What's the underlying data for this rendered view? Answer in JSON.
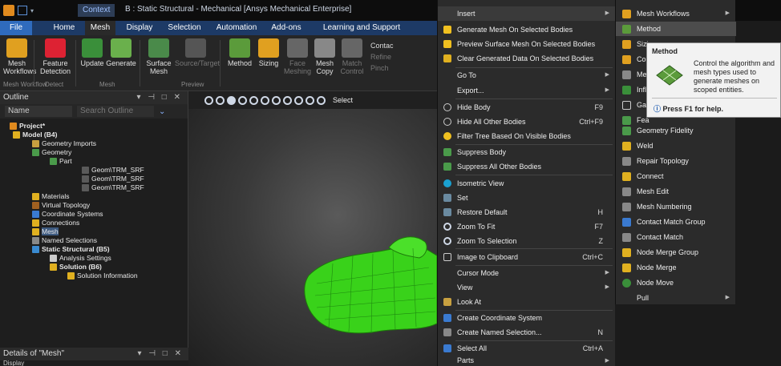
{
  "window": {
    "context_label": "Context",
    "title": "B : Static Structural - Mechanical [Ansys Mechanical Enterprise]"
  },
  "tabs": [
    "File",
    "Home",
    "Mesh",
    "Display",
    "Selection",
    "Automation",
    "Add-ons",
    "Learning and Support"
  ],
  "ribbon": {
    "mesh_workflows": "Mesh\nWorkflows",
    "feature_detection": "Feature\nDetection",
    "update": "Update",
    "generate": "Generate",
    "surface_mesh": "Surface\nMesh",
    "source_target": "Source/Target",
    "method": "Method",
    "sizing": "Sizing",
    "face_meshing": "Face\nMeshing",
    "mesh_copy": "Mesh\nCopy",
    "match_control": "Match\nControl",
    "contact": "Contac",
    "refine": "Refine",
    "pinch": "Pinch",
    "groups": {
      "mesh_workflow": "Mesh Workflow",
      "detect": "Detect",
      "mesh": "Mesh",
      "preview": "Preview"
    }
  },
  "outline": {
    "title": "Outline",
    "controls": "▾ ⊣ □ ✕",
    "name_label": "Name",
    "search_placeholder": "Search Outline",
    "tree": [
      {
        "label": "Project*",
        "bold": true
      },
      {
        "label": "Model (B4)",
        "bold": true
      },
      {
        "label": "Geometry Imports"
      },
      {
        "label": "Geometry"
      },
      {
        "label": "Part"
      },
      {
        "label": "Geom\\TRM_SRF"
      },
      {
        "label": "Geom\\TRM_SRF"
      },
      {
        "label": "Geom\\TRM_SRF"
      },
      {
        "label": "Materials"
      },
      {
        "label": "Virtual Topology"
      },
      {
        "label": "Coordinate Systems"
      },
      {
        "label": "Connections"
      },
      {
        "label": "Mesh"
      },
      {
        "label": "Named Selections"
      },
      {
        "label": "Static Structural (B5)",
        "bold": true
      },
      {
        "label": "Analysis Settings"
      },
      {
        "label": "Solution (B6)",
        "bold": true
      },
      {
        "label": "Solution Information"
      }
    ]
  },
  "details": {
    "title": "Details of \"Mesh\"",
    "section": "Display"
  },
  "viewport": {
    "select_label": "Select"
  },
  "context_menu": {
    "items": [
      {
        "label": "Insert",
        "arrow": "▶",
        "shortcut": ""
      },
      {
        "label": "Generate Mesh On Selected Bodies",
        "shortcut": ""
      },
      {
        "label": "Preview Surface Mesh On Selected Bodies",
        "shortcut": ""
      },
      {
        "label": "Clear Generated Data On Selected Bodies",
        "shortcut": ""
      },
      {
        "label": "Go To",
        "arrow": "▶",
        "shortcut": ""
      },
      {
        "label": "Export...",
        "arrow": "▶",
        "shortcut": ""
      },
      {
        "label": "Hide Body",
        "shortcut": "F9"
      },
      {
        "label": "Hide All Other Bodies",
        "shortcut": "Ctrl+F9"
      },
      {
        "label": "Filter Tree Based On Visible Bodies",
        "shortcut": ""
      },
      {
        "label": "Suppress Body",
        "shortcut": ""
      },
      {
        "label": "Suppress All Other Bodies",
        "shortcut": ""
      },
      {
        "label": "Isometric View",
        "shortcut": ""
      },
      {
        "label": "Set",
        "shortcut": ""
      },
      {
        "label": "Restore Default",
        "shortcut": "H"
      },
      {
        "label": "Zoom To Fit",
        "shortcut": "F7"
      },
      {
        "label": "Zoom To Selection",
        "shortcut": "Z"
      },
      {
        "label": "Image to Clipboard",
        "shortcut": "Ctrl+C"
      },
      {
        "label": "Cursor Mode",
        "arrow": "▶",
        "shortcut": ""
      },
      {
        "label": "View",
        "arrow": "▶",
        "shortcut": ""
      },
      {
        "label": "Look At",
        "shortcut": ""
      },
      {
        "label": "Create Coordinate System",
        "shortcut": ""
      },
      {
        "label": "Create Named Selection...",
        "shortcut": "N"
      },
      {
        "label": "Select All",
        "shortcut": "Ctrl+A"
      },
      {
        "label": "Parts",
        "arrow": "▶",
        "shortcut": ""
      }
    ]
  },
  "insert_submenu": {
    "items": [
      {
        "label": "Mesh Workflows",
        "arrow": "▶"
      },
      {
        "label": "Method"
      },
      {
        "label": "Sizi"
      },
      {
        "label": "Cor"
      },
      {
        "label": "Me:"
      },
      {
        "label": "Infl"
      },
      {
        "label": "Gas"
      },
      {
        "label": "Fea"
      },
      {
        "label": "Geometry Fidelity"
      },
      {
        "label": "Weld"
      },
      {
        "label": "Repair Topology"
      },
      {
        "label": "Connect"
      },
      {
        "label": "Mesh Edit"
      },
      {
        "label": "Mesh Numbering"
      },
      {
        "label": "Contact Match Group"
      },
      {
        "label": "Contact Match"
      },
      {
        "label": "Node Merge Group"
      },
      {
        "label": "Node Merge"
      },
      {
        "label": "Node Move"
      },
      {
        "label": "Pull",
        "arrow": "▶"
      }
    ]
  },
  "tooltip": {
    "title": "Method",
    "body": "Control the algorithm and mesh types used to generate meshes on scoped entities.",
    "help": "Press F1 for help."
  },
  "colors": {
    "accent_blue": "#1d3a66",
    "mesh_green": "#39d21a",
    "menu_bg": "#2b2b2b"
  }
}
